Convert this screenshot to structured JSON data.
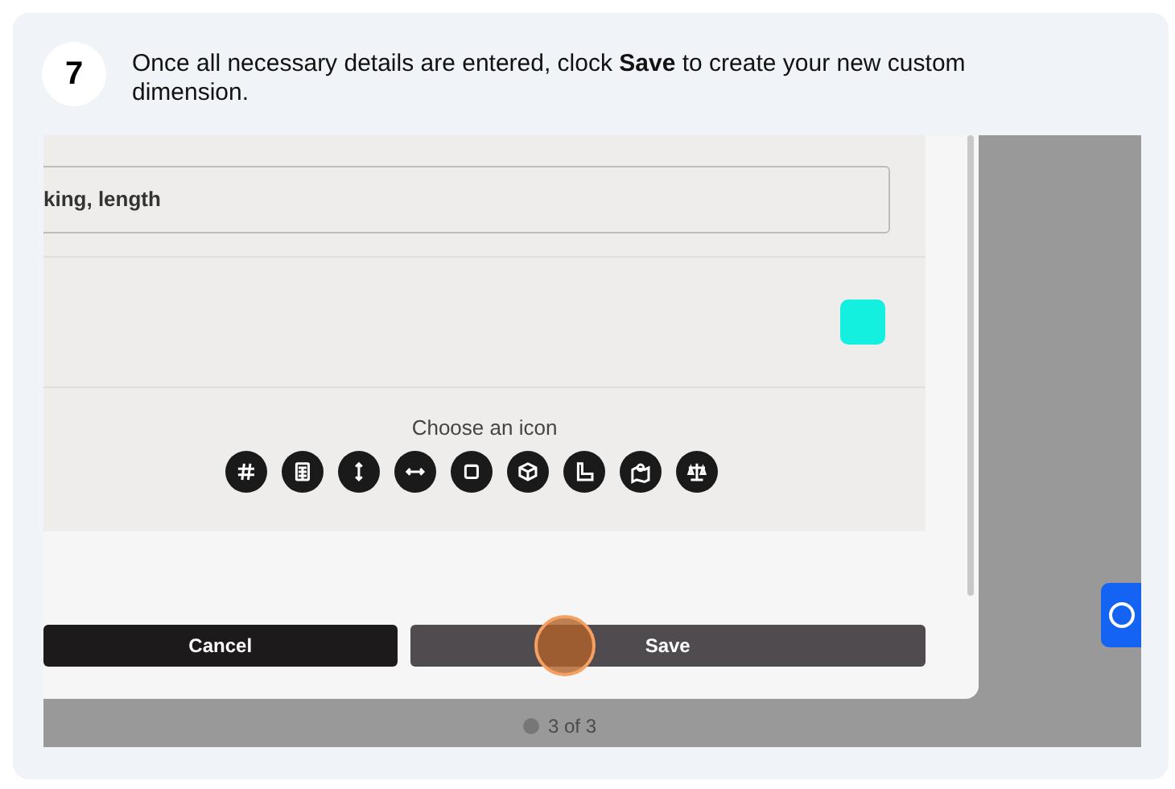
{
  "step": {
    "number": "7",
    "instruction": "Once all necessary details are entered, clock **Save** to create your new custom dimension."
  },
  "form": {
    "field_value": "king, length",
    "color_swatch": {
      "color": "#14f0e0"
    },
    "icon_picker": {
      "label": "Choose an icon"
    }
  },
  "buttons": [
    {
      "label": "Cancel",
      "kind": "secondary"
    },
    {
      "label": "Save",
      "kind": "primary",
      "clicked": true
    }
  ],
  "pager": "3 of 3"
}
